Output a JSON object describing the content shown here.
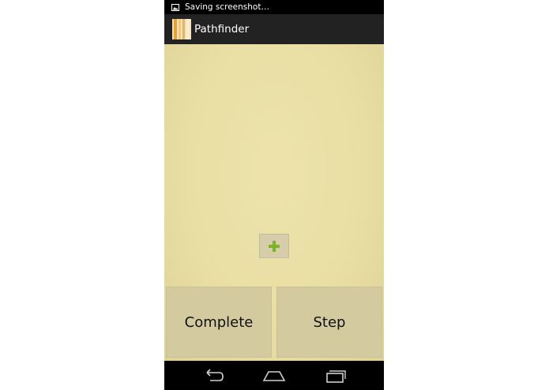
{
  "status_bar": {
    "notification_text": "Saving screenshot…",
    "icon": "image-icon"
  },
  "action_bar": {
    "title": "Pathfinder",
    "icon": "app-icon"
  },
  "content": {
    "add_button_icon": "plus-icon",
    "buttons": {
      "complete_label": "Complete",
      "step_label": "Step"
    }
  },
  "nav_bar": {
    "back_icon": "back-icon",
    "home_icon": "home-icon",
    "recent_icon": "recent-apps-icon"
  },
  "colors": {
    "content_background": "#e9dfa5",
    "button_background": "#d3caa0",
    "plus_color": "#7cb32b",
    "action_bar": "#222222"
  }
}
